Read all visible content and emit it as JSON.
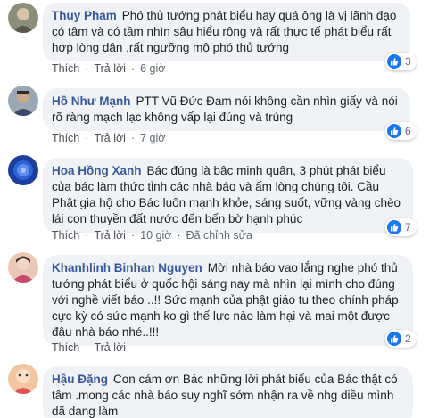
{
  "colors": {
    "author": "#385898",
    "bubble": "#f0f2f5",
    "like": "#1877f2",
    "meta": "#606770"
  },
  "comments": [
    {
      "author": "Thuy Pham",
      "text": "Phó thủ tướng phát biểu hay quá ông là vị lãnh đạo có tâm và có tầm nhìn sâu hiểu rộng và rất thực tế phát biểu rất hợp lòng dân ,rất ngưỡng mộ phó thủ tướng",
      "like_label": "Thích",
      "reply_label": "Trả lời",
      "time": "6 giờ",
      "edited": "",
      "reaction_icon": "like-icon",
      "reaction_count": "3"
    },
    {
      "author": "Hồ Như Mạnh",
      "text": "PTT Vũ Đức Đam nói không cần nhìn giấy và nói rõ ràng mạch lạc không vấp lại đúng và trúng",
      "like_label": "Thích",
      "reply_label": "Trả lời",
      "time": "7 giờ",
      "edited": "",
      "reaction_icon": "like-icon",
      "reaction_count": "6"
    },
    {
      "author": "Hoa Hồng Xanh",
      "text": "Bác đúng là bậc minh quân, 3 phút phát biểu của bác làm thức tỉnh các nhà báo và ấm lòng chúng tôi. Cầu Phật gia hộ cho Bác luôn mạnh khỏe, sáng suốt, vững vàng chèo lái con thuyền đất nước đến bến bờ hạnh phúc",
      "like_label": "Thích",
      "reply_label": "Trả lời",
      "time": "10 giờ",
      "edited": "Đã chỉnh sửa",
      "reaction_icon": "like-icon",
      "reaction_count": "7"
    },
    {
      "author": "Khanhlinh Binhan Nguyen",
      "text": "Mời nhà báo vao lắng nghe phó thủ tướng phát biểu ở quốc hội sáng nay mà nhìn lại mình cho đúng với nghề viết báo ..!! Sức mạnh của phật giáo tu theo chính pháp cực kỳ có sức mạnh ko gì thế lực nào làm hại và mai một được đâu nhà báo nhé..!!!",
      "like_label": "Thích",
      "reply_label": "Trả lời",
      "time": "",
      "edited": "",
      "reaction_icon": "like-icon",
      "reaction_count": "2"
    },
    {
      "author": "Hậu Đặng",
      "text": "Con cám ơn Bác những lời phát biểu của Bác thật có tâm .mong các nhà báo suy nghĩ sớm nhận ra về nhg diều mình dã dang làm",
      "like_label": "",
      "reply_label": "",
      "time": "",
      "edited": "",
      "reaction_icon": "",
      "reaction_count": ""
    }
  ]
}
